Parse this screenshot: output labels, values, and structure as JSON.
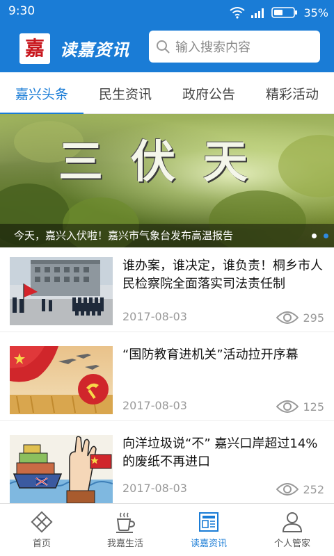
{
  "status_bar": {
    "time": "9:30",
    "battery": "35%"
  },
  "header": {
    "logo_char": "嘉",
    "title": "读嘉资讯",
    "search_placeholder": "输入搜索内容"
  },
  "tabs": [
    {
      "label": "嘉兴头条",
      "active": true
    },
    {
      "label": "民生资讯",
      "active": false
    },
    {
      "label": "政府公告",
      "active": false
    },
    {
      "label": "精彩活动",
      "active": false
    }
  ],
  "banner": {
    "title": "三伏天",
    "caption": "今天，嘉兴入伏啦！嘉兴市气象台发布高温报告",
    "slide_count": 2,
    "active_slide": 2
  },
  "news": [
    {
      "title": "谁办案，谁决定，谁负责！桐乡市人民检察院全面落实司法责任制",
      "date": "2017-08-03",
      "views": "295"
    },
    {
      "title": "“国防教育进机关”活动拉开序幕",
      "date": "2017-08-03",
      "views": "125"
    },
    {
      "title": "向洋垃圾说“不” 嘉兴口岸超过14%的废纸不再进口",
      "date": "2017-08-03",
      "views": "252"
    }
  ],
  "bottom_nav": [
    {
      "label": "首页",
      "icon": "diamond-icon",
      "active": false
    },
    {
      "label": "我嘉生活",
      "icon": "cup-icon",
      "active": false
    },
    {
      "label": "读嘉资讯",
      "icon": "newspaper-icon",
      "active": true
    },
    {
      "label": "个人管家",
      "icon": "person-icon",
      "active": false
    }
  ],
  "colors": {
    "primary": "#1a7cd6",
    "text": "#111111",
    "muted": "#999999"
  }
}
